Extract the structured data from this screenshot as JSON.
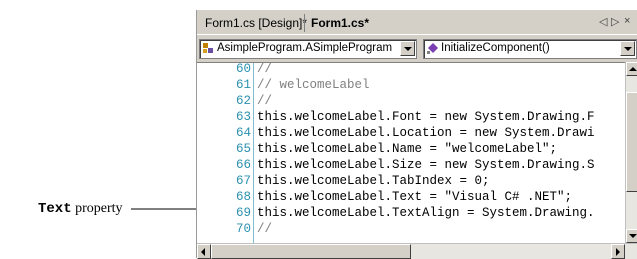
{
  "callout": {
    "keyword": "Text",
    "rest": " property"
  },
  "tabs": [
    {
      "label": "Form1.cs [Design]*"
    },
    {
      "label": "Form1.cs*"
    }
  ],
  "tab_controls": {
    "left": "◁",
    "right": "▷",
    "close": "×"
  },
  "combos": {
    "class_selector": "AsimpleProgram.ASimpleProgram",
    "member_selector": "InitializeComponent()"
  },
  "code_lines": [
    {
      "num": "60",
      "text": "//",
      "kind": "comment"
    },
    {
      "num": "61",
      "text": "// welcomeLabel",
      "kind": "comment"
    },
    {
      "num": "62",
      "text": "//",
      "kind": "comment"
    },
    {
      "num": "63",
      "text": "this.welcomeLabel.Font = new System.Drawing.F",
      "kind": "code"
    },
    {
      "num": "64",
      "text": "this.welcomeLabel.Location = new System.Drawi",
      "kind": "code"
    },
    {
      "num": "65",
      "text": "this.welcomeLabel.Name = \"welcomeLabel\";",
      "kind": "code"
    },
    {
      "num": "66",
      "text": "this.welcomeLabel.Size = new System.Drawing.S",
      "kind": "code"
    },
    {
      "num": "67",
      "text": "this.welcomeLabel.TabIndex = 0;",
      "kind": "code"
    },
    {
      "num": "68",
      "text": "this.welcomeLabel.Text = \"Visual C# .NET\";",
      "kind": "code"
    },
    {
      "num": "69",
      "text": "this.welcomeLabel.TextAlign = System.Drawing.",
      "kind": "code"
    },
    {
      "num": "70",
      "text": "//",
      "kind": "comment"
    }
  ]
}
